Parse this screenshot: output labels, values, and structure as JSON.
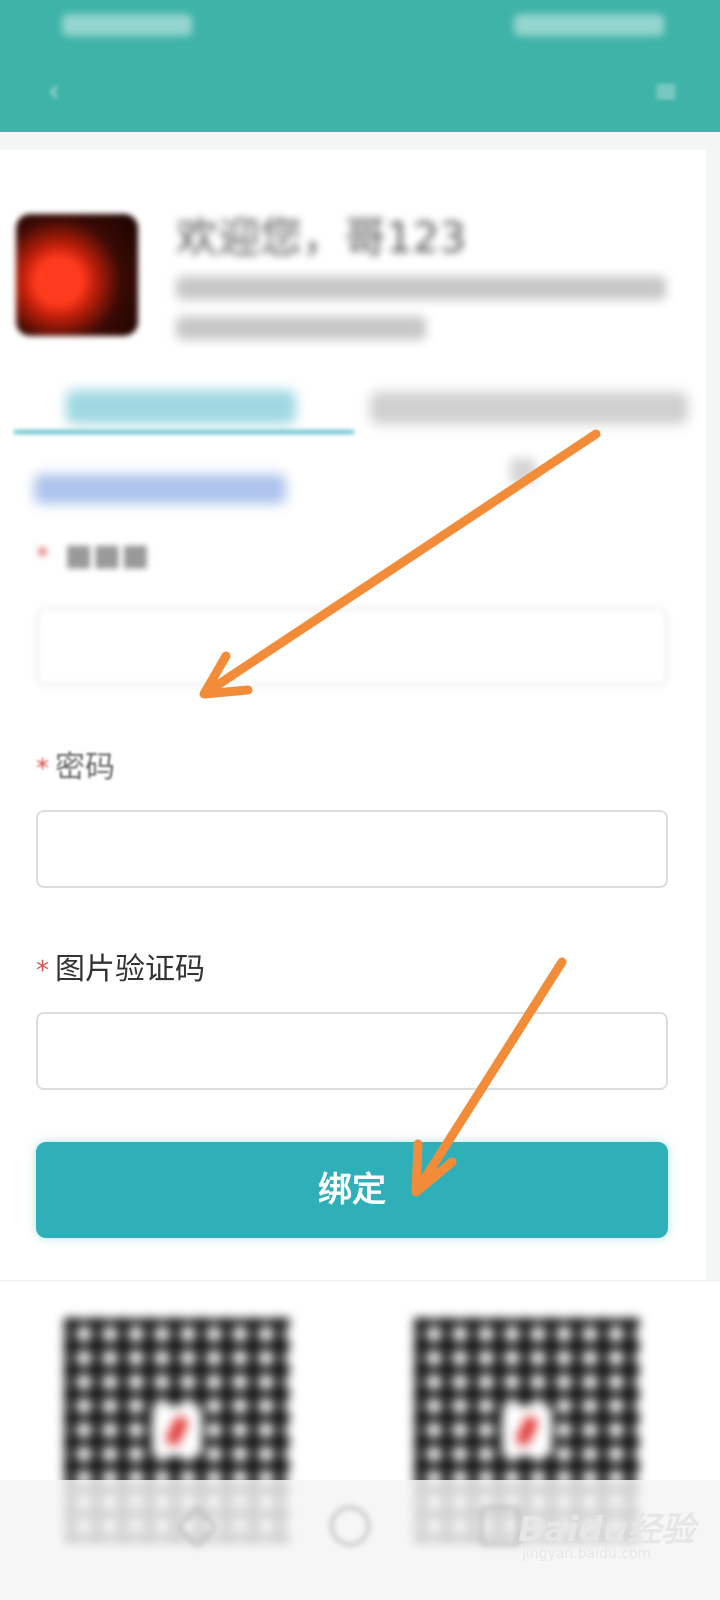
{
  "header": {
    "back_icon": "back-arrow-icon",
    "menu_icon": "menu-icon",
    "background_color": "#3fb3a8"
  },
  "profile": {
    "welcome": "欢迎您，哥123"
  },
  "form": {
    "password_label": "密码",
    "captcha_label": "图片验证码",
    "required_mark": "*",
    "submit_label": "绑定",
    "submit_color": "#2fb0b8"
  },
  "watermark": {
    "brand": "Bai",
    "brand_du": "du",
    "brand_cn": "经验",
    "sub": "jingyan.baidu.com"
  },
  "annotation": {
    "arrow_color": "#f28c38"
  }
}
